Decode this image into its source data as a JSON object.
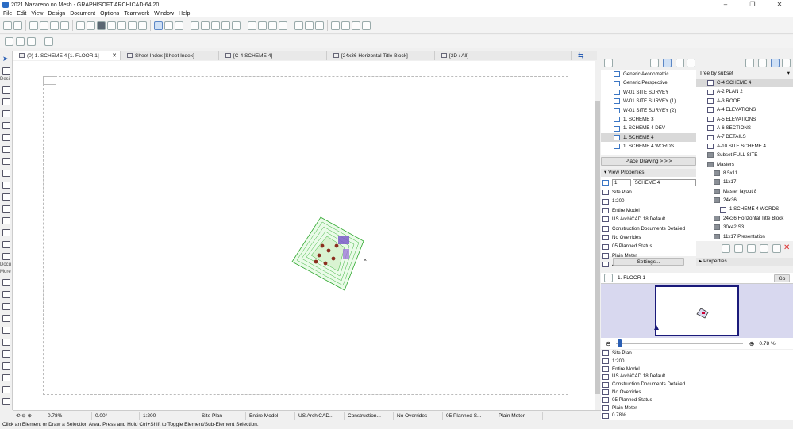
{
  "window": {
    "title": "2021 Nazareno no Mesh - GRAPHISOFT ARCHICAD-64 20",
    "controls": [
      "–",
      "❐",
      "✕"
    ]
  },
  "menu": [
    "File",
    "Edit",
    "View",
    "Design",
    "Document",
    "Options",
    "Teamwork",
    "Window",
    "Help"
  ],
  "toolbox": {
    "labels": [
      "Desi",
      "Docu",
      "More"
    ]
  },
  "tabs": [
    {
      "label": "(0) 1. SCHEME 4 [1. FLOOR 1]",
      "close": "✕"
    },
    {
      "label": "Sheet Index [Sheet Index]"
    },
    {
      "label": "[C-4 SCHEME 4]"
    },
    {
      "label": "[24x36 Horizontal Title Block]"
    },
    {
      "label": "[3D / All]"
    }
  ],
  "statusbar": {
    "zoom": "0.78%",
    "angle": "0.00°",
    "scale": "1:200",
    "layer_combo": "Site Plan",
    "model_view": "Entire Model",
    "pen_set": "US ArchiCAD...",
    "mvo": "Construction...",
    "overrides": "No Overrides",
    "renovation": "05 Planned S...",
    "dimension": "Plain Meter"
  },
  "hint": "Click an Element or Draw a Selection Area. Press and Hold Ctrl+Shift to Toggle Element/Sub-Element Selection.",
  "organizer_left": {
    "items": [
      "Generic Axonometric",
      "Generic Perspective",
      "W-01 SITE SURVEY",
      "W-01 SITE SURVEY (1)",
      "W-01 SITE SURVEY (2)",
      "1. SCHEME 3",
      "1. SCHEME 4 DEV",
      "1. SCHEME 4",
      "1. SCHEME 4 WORDS"
    ],
    "selected_index": 7,
    "place_drawing": "Place Drawing > > >",
    "view_properties_header": "View Properties",
    "view_id": "1.",
    "view_name": "SCHEME 4",
    "props": [
      "Site Plan",
      "1:200",
      "Entire Model",
      "US ArchiCAD 18 Default",
      "Construction Documents Detailed",
      "No Overrides",
      "05 Planned Status",
      "Plain Meter",
      "Zoomed area"
    ],
    "settings_button": "Settings..."
  },
  "organizer_right": {
    "header": "Tree by subset",
    "items": [
      {
        "label": "C-4 SCHEME 4",
        "kind": "sheet",
        "indent": 0
      },
      {
        "label": "A-2 PLAN 2",
        "kind": "sheet",
        "indent": 0
      },
      {
        "label": "A-3 ROOF",
        "kind": "sheet",
        "indent": 0
      },
      {
        "label": "A-4 ELEVATIONS",
        "kind": "sheet",
        "indent": 0
      },
      {
        "label": "A-5 ELEVATIONS",
        "kind": "sheet",
        "indent": 0
      },
      {
        "label": "A-6 SECTIONS",
        "kind": "sheet",
        "indent": 0
      },
      {
        "label": "A-7 DETAILS",
        "kind": "sheet",
        "indent": 0
      },
      {
        "label": "A-10 SITE SCHEME 4",
        "kind": "sheet",
        "indent": 0
      },
      {
        "label": "Subset FULL SITE",
        "kind": "folder",
        "indent": 0
      },
      {
        "label": "Masters",
        "kind": "folder",
        "indent": 0
      },
      {
        "label": "8.5x11",
        "kind": "folder",
        "indent": 1
      },
      {
        "label": "11x17",
        "kind": "folder",
        "indent": 1
      },
      {
        "label": "Master layout 8",
        "kind": "folder",
        "indent": 1
      },
      {
        "label": "24x36",
        "kind": "folder",
        "indent": 1
      },
      {
        "label": "1 SCHEME 4 WORDS",
        "kind": "sheet",
        "indent": 2
      },
      {
        "label": "24x36 Horizontal Title Block",
        "kind": "folder",
        "indent": 1
      },
      {
        "label": "30x42 S3",
        "kind": "folder",
        "indent": 1
      },
      {
        "label": "11x17 Presentation",
        "kind": "folder",
        "indent": 1
      }
    ],
    "selected_index": 0,
    "properties_header": "Properties"
  },
  "navigator": {
    "floor": "1. FLOOR 1",
    "go": "Go",
    "zoom": "0.78 %"
  },
  "bottom_props": [
    "Site Plan",
    "1:200",
    "Entire Model",
    "US ArchiCAD 18 Default",
    "Construction Documents Detailed",
    "No Overrides",
    "05 Planned Status",
    "Plain Meter",
    "0.78%",
    "0.00°"
  ],
  "colors": {
    "accent": "#2b5fb4",
    "site_green": "#2fa72f",
    "navigator_bg": "#d8d8ef",
    "navigator_frame": "#1a1a7a"
  }
}
